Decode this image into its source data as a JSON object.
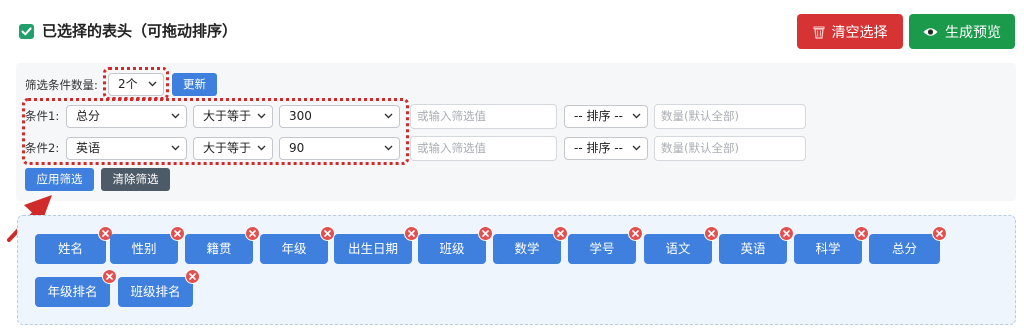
{
  "header": {
    "title": "已选择的表头（可拖动排序）",
    "clear_button": "清空选择",
    "preview_button": "生成预览"
  },
  "filter": {
    "count_label": "筛选条件数量:",
    "count_value": "2个",
    "update_button": "更新",
    "conditions": [
      {
        "label": "条件1:",
        "field": "总分",
        "operator": "大于等于",
        "value": "300",
        "input_placeholder": "或输入筛选值",
        "sort": "-- 排序 --",
        "count_placeholder": "数量(默认全部)"
      },
      {
        "label": "条件2:",
        "field": "英语",
        "operator": "大于等于",
        "value": "90",
        "input_placeholder": "或输入筛选值",
        "sort": "-- 排序 --",
        "count_placeholder": "数量(默认全部)"
      }
    ],
    "apply_button": "应用筛选",
    "clear_filter_button": "清除筛选"
  },
  "columns": [
    "姓名",
    "性别",
    "籍贯",
    "年级",
    "出生日期",
    "班级",
    "数学",
    "学号",
    "语文",
    "英语",
    "科学",
    "总分",
    "年级排名",
    "班级排名"
  ],
  "icons": {
    "header_check": "check-square-icon",
    "clear": "trash-icon",
    "preview": "eye-icon",
    "remove": "close-icon",
    "arrow": "pointer-arrow-icon"
  },
  "colors": {
    "primary": "#3f7fdd",
    "danger": "#d63434",
    "success": "#1c9a4c",
    "highlight": "#d02a2a",
    "secondary": "#4d5a67"
  }
}
